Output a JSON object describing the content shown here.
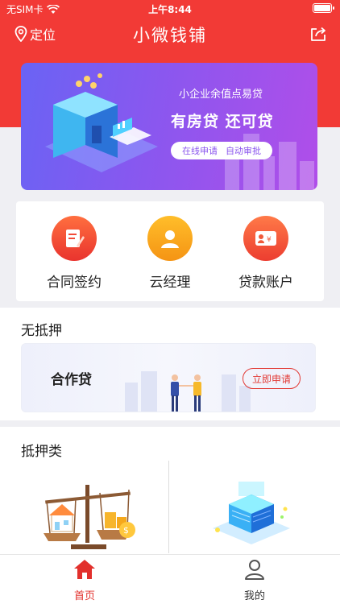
{
  "status_bar": {
    "carrier": "无SIM卡",
    "time": "上午8:44"
  },
  "nav": {
    "location_label": "定位",
    "title": "小微钱铺"
  },
  "banner": {
    "subtitle": "小企业余值点易贷",
    "headline": "有房贷  还可贷",
    "tag_online": "在线申请",
    "tag_auto": "自动审批"
  },
  "quick": [
    {
      "label": "合同签约",
      "color": "#f44b3a"
    },
    {
      "label": "云经理",
      "color": "#f7a21b"
    },
    {
      "label": "贷款账户",
      "color": "#f25c3d"
    }
  ],
  "section_unsecured": {
    "title": "无抵押",
    "card_title": "合作贷",
    "button": "立即申请"
  },
  "section_secured": {
    "title": "抵押类"
  },
  "tabbar": {
    "home": "首页",
    "mine": "我的",
    "active_color": "#e2302c"
  }
}
